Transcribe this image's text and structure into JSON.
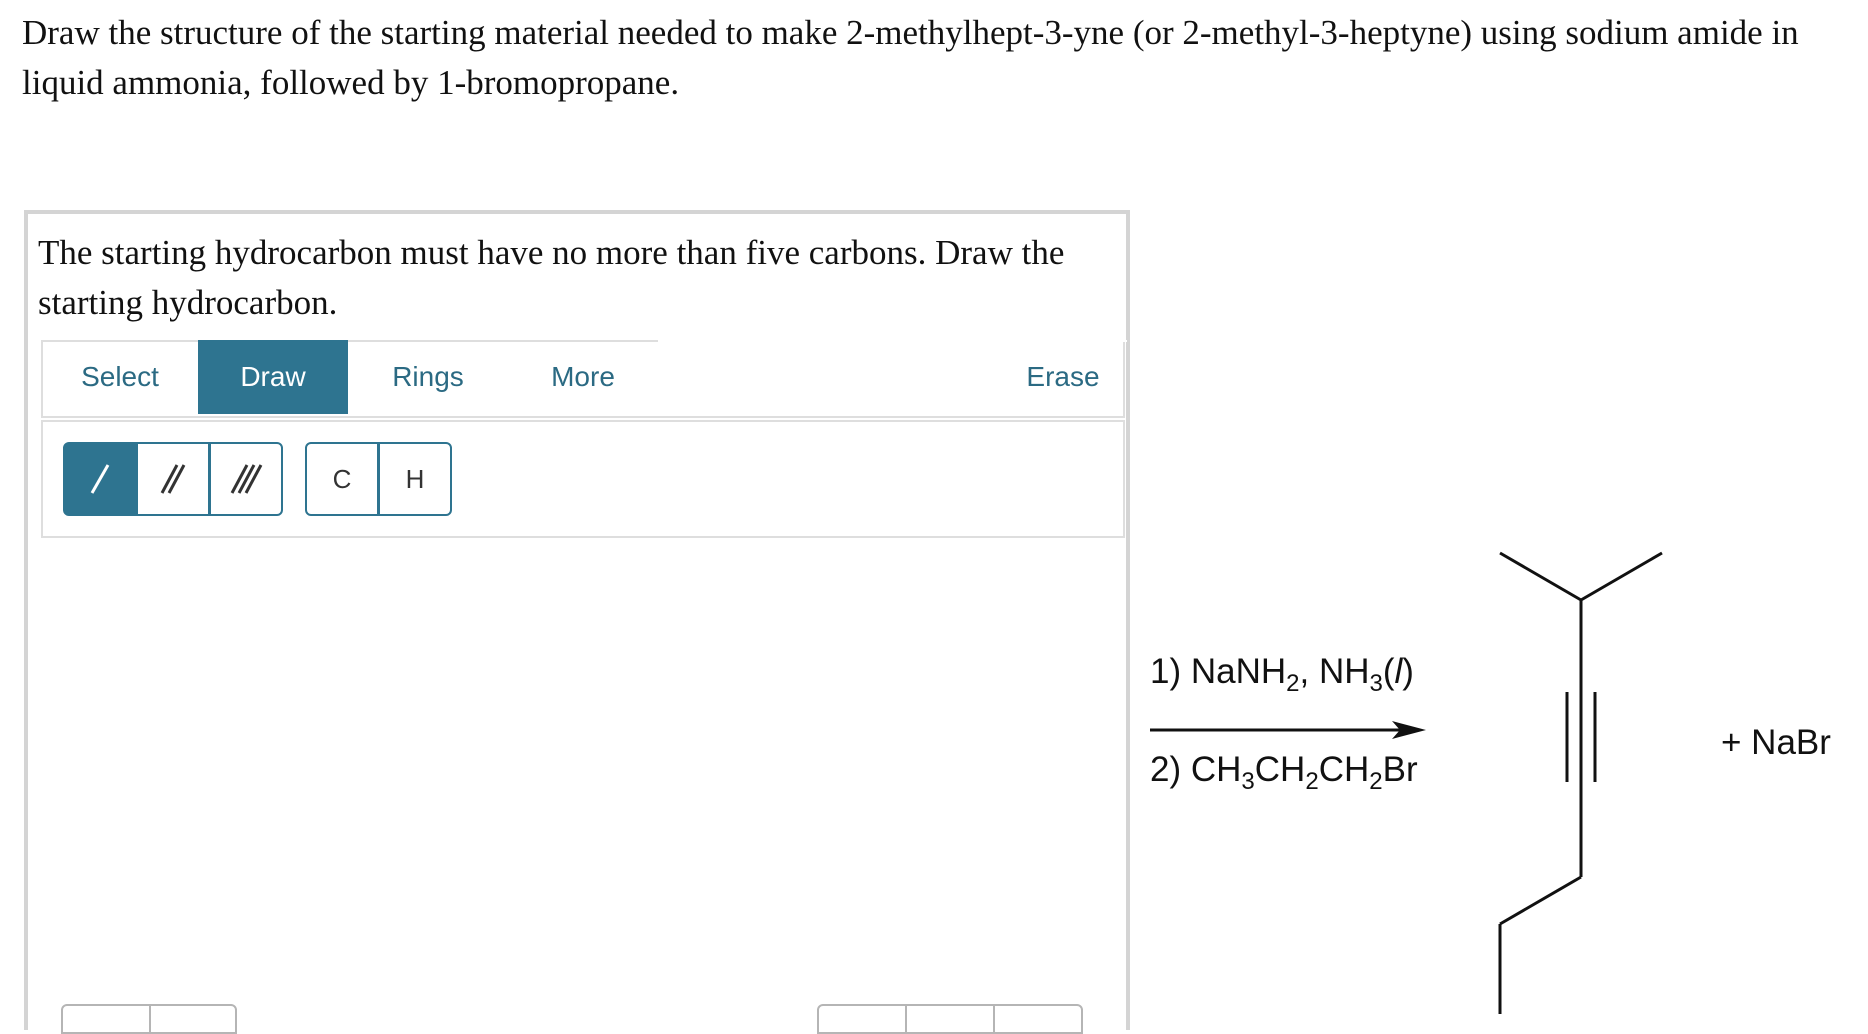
{
  "question": {
    "text": "Draw the structure of the starting material needed to make 2-methylhept-3-yne (or 2-methyl-3-heptyne) using sodium amide in liquid ammonia, followed by 1-bromopropane."
  },
  "panel": {
    "prompt": "The starting hydrocarbon must have no more than five carbons. Draw the starting hydrocarbon."
  },
  "tabs": [
    {
      "label": "Select",
      "active": false
    },
    {
      "label": "Draw",
      "active": true
    },
    {
      "label": "Rings",
      "active": false
    },
    {
      "label": "More",
      "active": false
    },
    {
      "label": "Erase",
      "active": false
    }
  ],
  "tools": {
    "bond_tools": [
      {
        "icon": "single-bond-icon",
        "active": true
      },
      {
        "icon": "double-bond-icon",
        "active": false
      },
      {
        "icon": "triple-bond-icon",
        "active": false
      }
    ],
    "atoms": [
      "C",
      "H"
    ]
  },
  "reaction": {
    "step1": {
      "num": "1) NaNH",
      "sub1": "2",
      "mid": ", NH",
      "sub2": "3",
      "open": "(",
      "italic": "l",
      "close": ")"
    },
    "step2": {
      "num": "2) CH",
      "sub1": "3",
      "a": "CH",
      "sub2": "2",
      "b": "CH",
      "sub3": "2",
      "c": "Br"
    },
    "byproduct": "+ NaBr"
  },
  "colors": {
    "accent": "#2e7490",
    "accent_text": "#2b6a83",
    "border": "#d4d4d4"
  }
}
